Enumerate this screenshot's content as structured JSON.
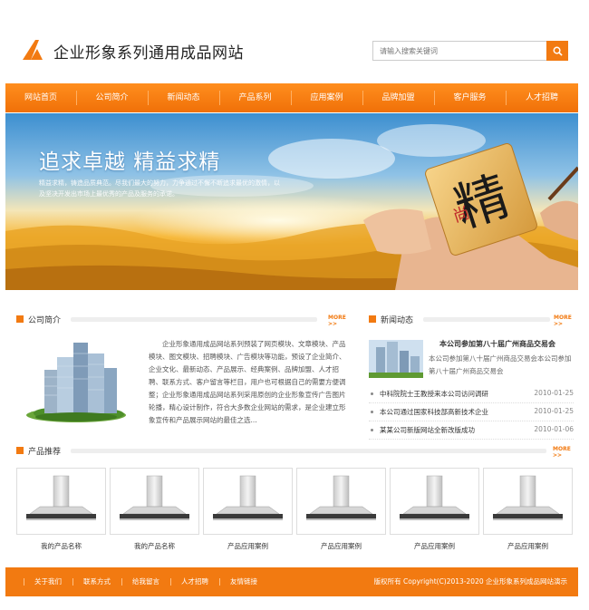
{
  "header": {
    "site_title": "企业形象系列通用成品网站",
    "search_placeholder": "请输入搜索关键词"
  },
  "nav": {
    "items": [
      "网站首页",
      "公司简介",
      "新闻动态",
      "产品系列",
      "应用案例",
      "品牌加盟",
      "客户服务",
      "人才招聘"
    ]
  },
  "banner": {
    "title": "追求卓越 精益求精",
    "subtitle": "精益求精，铸造品质典范。尽我们最大的努力，力争通过不懈不断追求最优的激情，以及坚决开发出市场上最优秀的产品及服务的承诺。"
  },
  "about": {
    "title": "公司简介",
    "more": "MORE >>",
    "text": "企业形象通用成品网站系列预装了网页模块、文章模块、产品模块、图文模块、招聘模块、广告模块等功能，预设了企业简介、企业文化、最新动态、产品展示、经典案例、品牌加盟、人才招聘、联系方式、客户留言等栏目，用户也可根据自己的需要方便调整；企业形象通用成品网站系列采用原创的企业形象宣传广告图片轮播，精心设计制作，符合大多数企业网站的需求，是企业建立形象宣传和产品展示网站的最佳之选..."
  },
  "news": {
    "title": "新闻动态",
    "more": "MORE >>",
    "featured_title": "本公司参加第八十届广州商品交易会",
    "featured_text": "本公司参加第八十届广州商品交易会本公司参加第八十届广州商品交易会",
    "list": [
      {
        "title": "中科院院士王教授来本公司访问调研",
        "date": "2010-01-25"
      },
      {
        "title": "本公司通过国家科技部高新技术企业",
        "date": "2010-01-25"
      },
      {
        "title": "某某公司新版网站全新改版成功",
        "date": "2010-01-06"
      }
    ]
  },
  "products": {
    "title": "产品推荐",
    "more": "MORE >>",
    "items": [
      {
        "name": "我的产品名称"
      },
      {
        "name": "我的产品名称"
      },
      {
        "name": "产品应用案例"
      },
      {
        "name": "产品应用案例"
      },
      {
        "name": "产品应用案例"
      },
      {
        "name": "产品应用案例"
      }
    ]
  },
  "footer": {
    "links": [
      "关于我们",
      "联系方式",
      "给我留言",
      "人才招聘",
      "友情链接"
    ],
    "copyright": "版权所有 Copyright(C)2013-2020 企业形象系列成品网站演示"
  },
  "colors": {
    "accent": "#f27a11",
    "nav_top": "#ff8e1e",
    "nav_bottom": "#f07008"
  }
}
